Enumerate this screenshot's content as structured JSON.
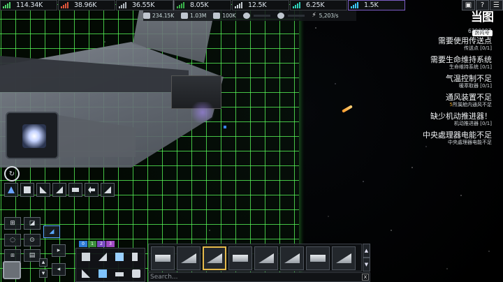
{
  "resources": [
    {
      "value": "114.34K",
      "color": "#4fd36a"
    },
    {
      "value": "38.96K",
      "color": "#e0553b"
    },
    {
      "value": "36.55K",
      "color": "#b0b6bd"
    },
    {
      "value": "8.05K",
      "color": "#39b24a"
    },
    {
      "value": "12.5K",
      "color": "#c7cdd3"
    },
    {
      "value": "6.25K",
      "color": "#2fd0b8"
    },
    {
      "value": "1.5K",
      "color": "#3cc9ff"
    }
  ],
  "stats": {
    "mass": "234.15K",
    "armor": "1.03M",
    "shield": "100K",
    "speed": "",
    "thrust": "",
    "power": "5,203/s"
  },
  "top_buttons": {
    "help": "?",
    "menu": "☰"
  },
  "logo": {
    "mark": "当图",
    "sub": "房间号"
  },
  "room_id": "6300987",
  "warnings": [
    {
      "title": "需要使用传送点",
      "detail": "传送点",
      "count": "[0/1]"
    },
    {
      "title": "需要生命维持系统",
      "detail": "生命维持系统",
      "count": "[0/1]"
    },
    {
      "title": "气温控制不足",
      "detail": "暖萃取器",
      "count": "[0/1]"
    },
    {
      "title": "通风装置不足",
      "detail": "所属舱内通风不足",
      "count": "5",
      "count_first": true
    },
    {
      "title": "缺少机动推进器！",
      "detail": "机动推进器",
      "count": "[0/1]"
    },
    {
      "title": "中央處理器电能不足",
      "detail": "中央處理器电能不足",
      "count": ""
    }
  ],
  "palette_tabs": [
    "0",
    "1",
    "2",
    "3"
  ],
  "palette_tab_colors": [
    "#2f7bd6",
    "#3c8f3c",
    "#7a4ac2",
    "#a04ac2"
  ],
  "hotbar": {
    "selected_index": 2,
    "slot_count": 8
  },
  "search": {
    "placeholder": "Search...",
    "clear": "x"
  },
  "colors": {
    "grid": "#5aff5a",
    "accent": "#e6b94a",
    "active_tool": "#5aa8ff"
  }
}
